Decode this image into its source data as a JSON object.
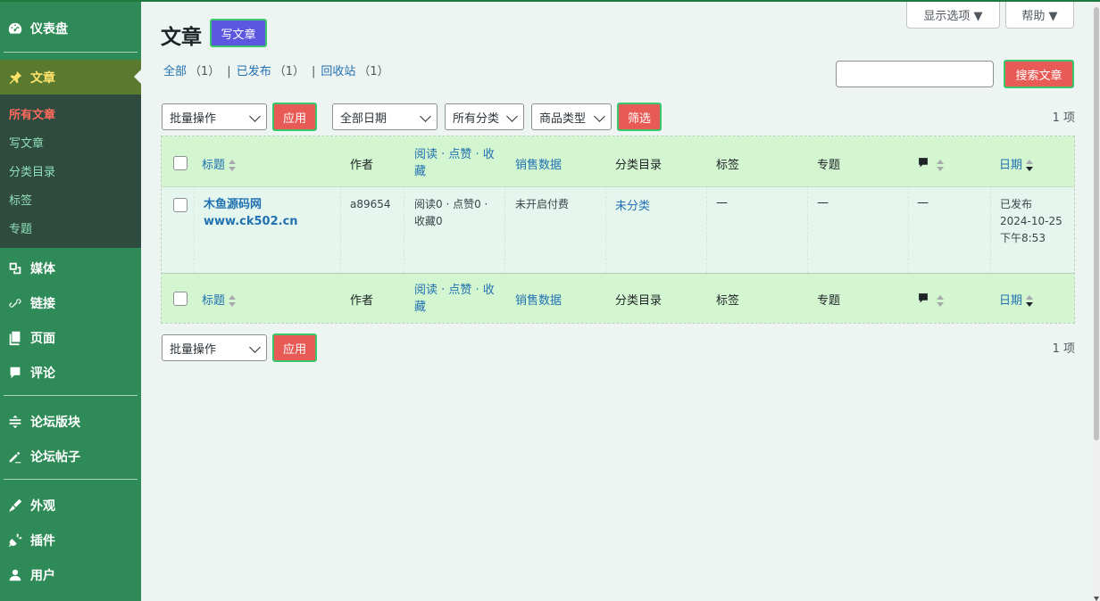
{
  "sidebar": {
    "dashboard": "仪表盘",
    "posts": "文章",
    "sub": [
      "所有文章",
      "写文章",
      "分类目录",
      "标签",
      "专题"
    ],
    "media": "媒体",
    "links": "链接",
    "pages": "页面",
    "comments": "评论",
    "forum_sections": "论坛版块",
    "forum_posts": "论坛帖子",
    "appearance": "外观",
    "plugins": "插件",
    "users": "用户"
  },
  "header": {
    "title": "文章",
    "add_new": "写文章",
    "screen_options": "显示选项 ▼",
    "help": "帮助 ▼"
  },
  "status": {
    "all": "全部",
    "all_count": "（1）",
    "published": "已发布",
    "published_count": "（1）",
    "trash": "回收站",
    "trash_count": "（1）"
  },
  "search": {
    "button": "搜索文章",
    "value": ""
  },
  "toolbar": {
    "bulk": "批量操作",
    "apply": "应用",
    "dates": "全部日期",
    "cats": "所有分类",
    "types": "商品类型",
    "filter": "筛选",
    "items": "1 项"
  },
  "columns": {
    "title": "标题",
    "author": "作者",
    "stats": "阅读 · 点赞 · 收藏",
    "sales": "销售数据",
    "cats": "分类目录",
    "tags": "标签",
    "topics": "专题",
    "date": "日期"
  },
  "row": {
    "title_line1": "木鱼源码网",
    "title_line2": "www.ck502.cn",
    "author": "a89654",
    "stats": "阅读0 · 点赞0 · 收藏0",
    "sales": "未开启付费",
    "cats": "未分类",
    "tags": "—",
    "topics": "—",
    "comments": "—",
    "date_status": "已发布",
    "date_day": "2024-10-25",
    "date_time": "下午8:53"
  },
  "colors": {
    "sidebar": "#2e8b57",
    "active": "#5a7a30",
    "header_row": "#d3f5cf",
    "red_button": "#e85a55",
    "add_button": "#5b57e0"
  }
}
